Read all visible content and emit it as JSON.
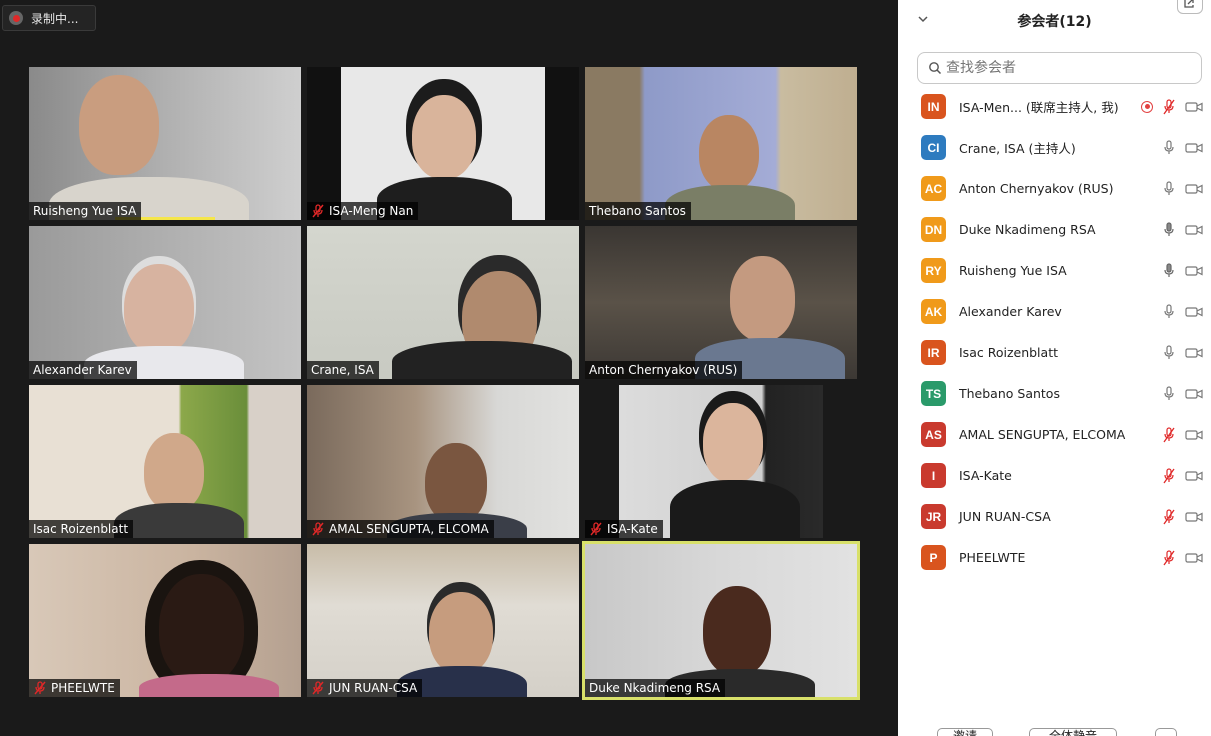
{
  "recording": {
    "label": "录制中..."
  },
  "colors": {
    "speaking_highlight": "#d8e06a",
    "mute_red": "#e02828",
    "panel_bg": "#ffffff"
  },
  "gallery": [
    {
      "name": "Ruisheng Yue ISA",
      "muted": false,
      "speaking": false
    },
    {
      "name": "ISA-Meng Nan",
      "muted": true,
      "speaking": false
    },
    {
      "name": "Thebano Santos",
      "muted": false,
      "speaking": false
    },
    {
      "name": "Alexander Karev",
      "muted": false,
      "speaking": false
    },
    {
      "name": "Crane, ISA",
      "muted": false,
      "speaking": false
    },
    {
      "name": "Anton Chernyakov (RUS)",
      "muted": false,
      "speaking": false
    },
    {
      "name": "Isac Roizenblatt",
      "muted": false,
      "speaking": false
    },
    {
      "name": "AMAL SENGUPTA, ELCOMA",
      "muted": true,
      "speaking": false
    },
    {
      "name": "ISA-Kate",
      "muted": true,
      "speaking": false
    },
    {
      "name": "PHEELWTE",
      "muted": true,
      "speaking": false
    },
    {
      "name": "JUN RUAN-CSA",
      "muted": true,
      "speaking": false
    },
    {
      "name": "Duke Nkadimeng RSA",
      "muted": false,
      "speaking": true
    }
  ],
  "panel": {
    "title": "参会者(12)",
    "search_placeholder": "查找参会者",
    "participants": [
      {
        "initials": "IN",
        "name": "ISA-Men... (联席主持人, 我)",
        "color": "#d9541e",
        "mic": "muted",
        "recording": true
      },
      {
        "initials": "CI",
        "name": "Crane, ISA (主持人)",
        "color": "#2e7bbf",
        "mic": "on",
        "recording": false
      },
      {
        "initials": "AC",
        "name": "Anton Chernyakov (RUS)",
        "color": "#f09a1a",
        "mic": "on",
        "recording": false
      },
      {
        "initials": "DN",
        "name": "Duke Nkadimeng RSA",
        "color": "#f09a1a",
        "mic": "active",
        "recording": false
      },
      {
        "initials": "RY",
        "name": "Ruisheng Yue ISA",
        "color": "#f09a1a",
        "mic": "active",
        "recording": false
      },
      {
        "initials": "AK",
        "name": "Alexander Karev",
        "color": "#f09a1a",
        "mic": "on",
        "recording": false
      },
      {
        "initials": "IR",
        "name": "Isac Roizenblatt",
        "color": "#d9541e",
        "mic": "on",
        "recording": false
      },
      {
        "initials": "TS",
        "name": "Thebano Santos",
        "color": "#2a9a6a",
        "mic": "on",
        "recording": false
      },
      {
        "initials": "AS",
        "name": "AMAL SENGUPTA, ELCOMA",
        "color": "#c93a2e",
        "mic": "muted",
        "recording": false
      },
      {
        "initials": "I",
        "name": "ISA-Kate",
        "color": "#c93a2e",
        "mic": "muted",
        "recording": false
      },
      {
        "initials": "JR",
        "name": "JUN RUAN-CSA",
        "color": "#c93a2e",
        "mic": "muted",
        "recording": false
      },
      {
        "initials": "P",
        "name": "PHEELWTE",
        "color": "#d9541e",
        "mic": "muted",
        "recording": false
      }
    ],
    "footer": {
      "invite_label": "邀请",
      "mute_all_label": "全体静音"
    }
  }
}
